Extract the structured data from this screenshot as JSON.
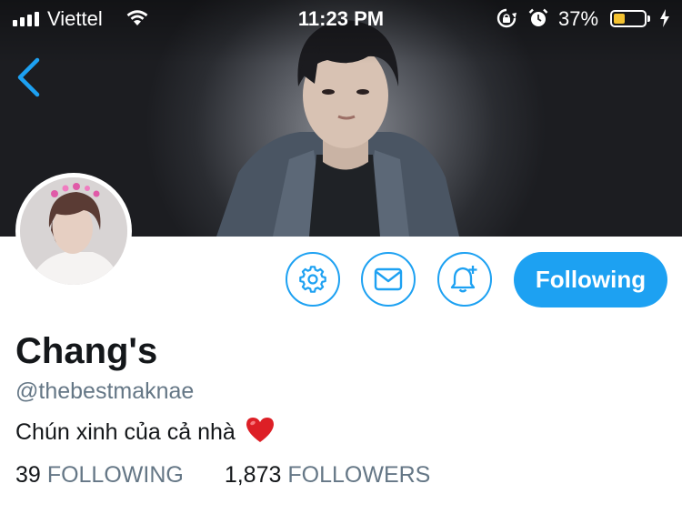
{
  "status_bar": {
    "carrier": "Viettel",
    "time": "11:23 PM",
    "battery_percent": "37%",
    "battery_level": 0.37,
    "battery_color": "#f4c230"
  },
  "header": {
    "back_icon": "chevron-left-icon"
  },
  "actions": {
    "settings_icon": "gear-icon",
    "message_icon": "envelope-icon",
    "notify_icon": "bell-plus-icon",
    "follow_label": "Following",
    "accent_color": "#1da1f2"
  },
  "profile": {
    "display_name": "Chang's",
    "handle": "@thebestmaknae",
    "bio": "Chún xinh của cả nhà",
    "bio_emoji": "heart-emoji"
  },
  "stats": {
    "following_count": "39",
    "following_label": "FOLLOWING",
    "followers_count": "1,873",
    "followers_label": "FOLLOWERS"
  }
}
